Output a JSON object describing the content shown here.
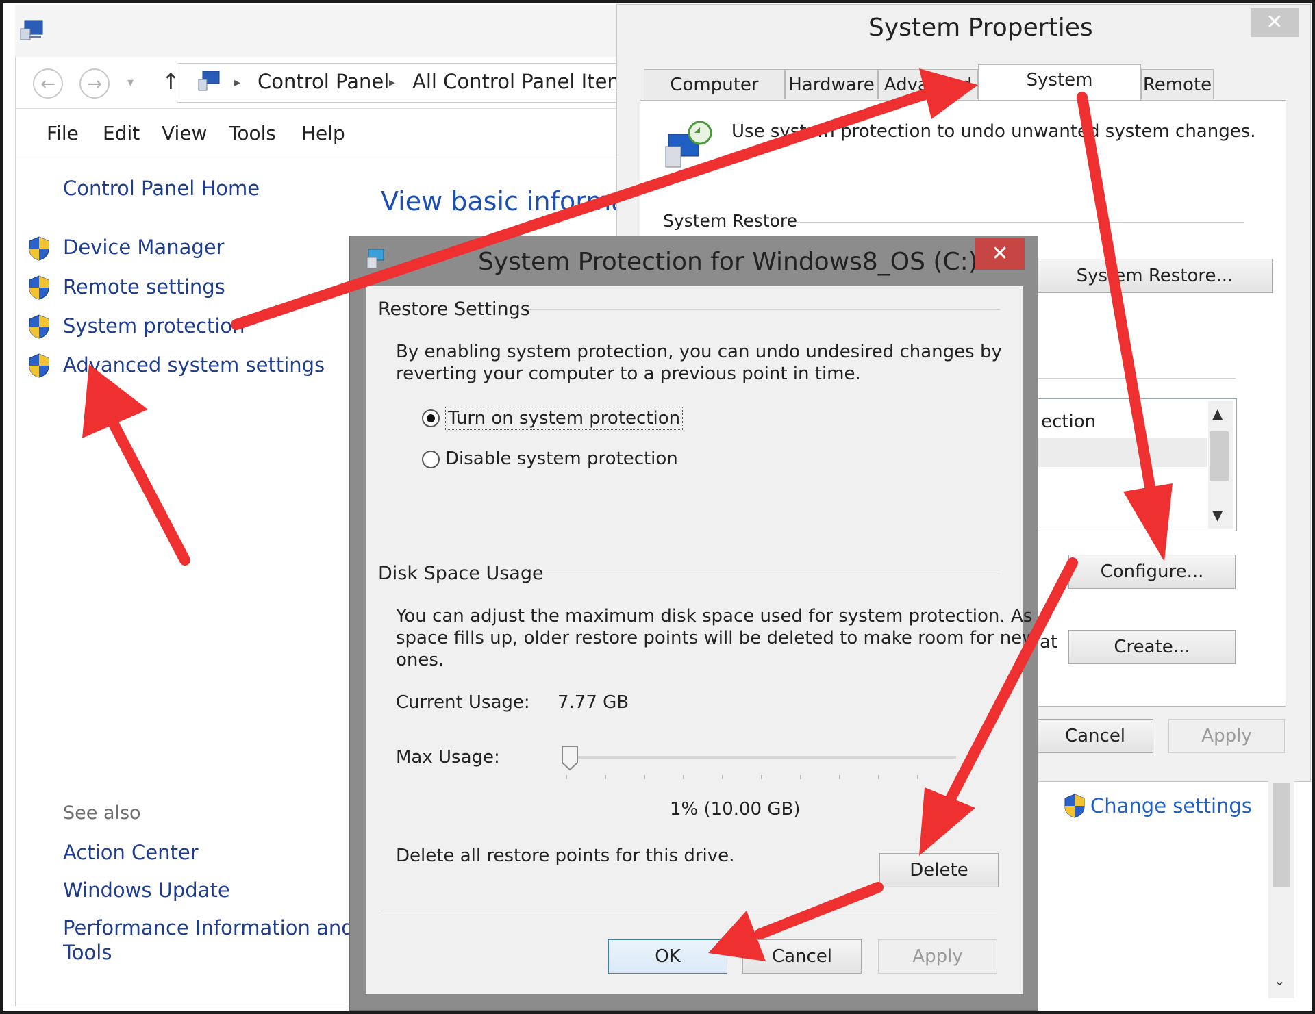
{
  "control_panel": {
    "breadcrumb": [
      "Control Panel",
      "All Control Panel Items"
    ],
    "menu": [
      "File",
      "Edit",
      "View",
      "Tools",
      "Help"
    ],
    "home_link": "Control Panel Home",
    "sidebar_links": [
      "Device Manager",
      "Remote settings",
      "System protection",
      "Advanced system settings"
    ],
    "heading": "View basic informati",
    "see_also": "See also",
    "see_also_links": [
      "Action Center",
      "Windows Update",
      "Performance Information and",
      "Tools"
    ]
  },
  "system_properties": {
    "title": "System Properties",
    "close": "✕",
    "tabs": [
      "Computer Name",
      "Hardware",
      "Advanced",
      "System Protection",
      "Remote"
    ],
    "description": "Use system protection to undo unwanted system changes.",
    "system_restore_group": "System Restore",
    "system_restore_button": "System Restore...",
    "list_fragment": "ection",
    "configure_button": "Configure...",
    "create_fragment": "at",
    "create_button": "Create...",
    "cancel_button": "Cancel",
    "apply_button": "Apply",
    "change_settings": "Change settings"
  },
  "dialog": {
    "title": "System Protection for Windows8_OS (C:)",
    "close": "✕",
    "restore_settings_label": "Restore Settings",
    "restore_text_1": "By enabling system protection, you can undo undesired changes by",
    "restore_text_2": "reverting your computer to a previous point in time.",
    "radio_on": "Turn on system protection",
    "radio_off": "Disable system protection",
    "disk_usage_label": "Disk Space Usage",
    "disk_text_1": "You can adjust the maximum disk space used for system protection. As",
    "disk_text_2": "space fills up, older restore points will be deleted to make room for new",
    "disk_text_3": "ones.",
    "current_usage_label": "Current Usage:",
    "current_usage_value": "7.77 GB",
    "max_usage_label": "Max Usage:",
    "max_usage_value": "1% (10.00 GB)",
    "max_usage_fraction": 0.01,
    "delete_text": "Delete all restore points for this drive.",
    "delete_button": "Delete",
    "ok_button": "OK",
    "cancel_button": "Cancel",
    "apply_button": "Apply"
  },
  "colors": {
    "arrow": "#ee3030",
    "link": "#1e3d8f",
    "close_red": "#c74542"
  }
}
